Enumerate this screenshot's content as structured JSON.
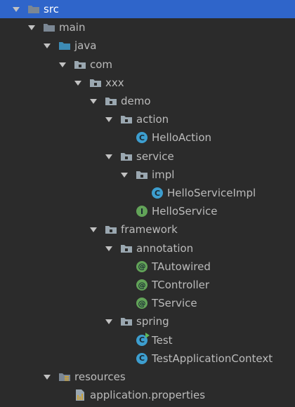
{
  "tree": [
    {
      "key": "src",
      "label": "src",
      "depth": 0,
      "expanded": true,
      "icon": "folder-icon",
      "icon_color": "#7b8794",
      "selected": true
    },
    {
      "key": "main",
      "label": "main",
      "depth": 1,
      "expanded": true,
      "icon": "folder-icon",
      "icon_color": "#7b8794"
    },
    {
      "key": "java",
      "label": "java",
      "depth": 2,
      "expanded": true,
      "icon": "source-folder-icon",
      "icon_color": "#3d8bb5"
    },
    {
      "key": "com",
      "label": "com",
      "depth": 3,
      "expanded": true,
      "icon": "package-icon",
      "icon_color": "#9aa7b0"
    },
    {
      "key": "xxx",
      "label": "xxx",
      "depth": 4,
      "expanded": true,
      "icon": "package-icon",
      "icon_color": "#9aa7b0"
    },
    {
      "key": "demo",
      "label": "demo",
      "depth": 5,
      "expanded": true,
      "icon": "package-icon",
      "icon_color": "#9aa7b0"
    },
    {
      "key": "action",
      "label": "action",
      "depth": 6,
      "expanded": true,
      "icon": "package-icon",
      "icon_color": "#9aa7b0"
    },
    {
      "key": "HelloAction",
      "label": "HelloAction",
      "depth": 7,
      "icon": "class-icon",
      "glyph": "C"
    },
    {
      "key": "service",
      "label": "service",
      "depth": 6,
      "expanded": true,
      "icon": "package-icon",
      "icon_color": "#9aa7b0"
    },
    {
      "key": "impl",
      "label": "impl",
      "depth": 7,
      "expanded": true,
      "icon": "package-icon",
      "icon_color": "#9aa7b0"
    },
    {
      "key": "HelloServiceImpl",
      "label": "HelloServiceImpl",
      "depth": 8,
      "icon": "class-icon",
      "glyph": "C"
    },
    {
      "key": "HelloService",
      "label": "HelloService",
      "depth": 7,
      "icon": "interface-icon",
      "glyph": "I"
    },
    {
      "key": "framework",
      "label": "framework",
      "depth": 5,
      "expanded": true,
      "icon": "package-icon",
      "icon_color": "#9aa7b0"
    },
    {
      "key": "annotation",
      "label": "annotation",
      "depth": 6,
      "expanded": true,
      "icon": "package-icon",
      "icon_color": "#9aa7b0"
    },
    {
      "key": "TAutowired",
      "label": "TAutowired",
      "depth": 7,
      "icon": "annotation-icon",
      "glyph": "@"
    },
    {
      "key": "TController",
      "label": "TController",
      "depth": 7,
      "icon": "annotation-icon",
      "glyph": "@"
    },
    {
      "key": "TService",
      "label": "TService",
      "depth": 7,
      "icon": "annotation-icon",
      "glyph": "@"
    },
    {
      "key": "spring",
      "label": "spring",
      "depth": 6,
      "expanded": true,
      "icon": "package-icon",
      "icon_color": "#9aa7b0"
    },
    {
      "key": "Test",
      "label": "Test",
      "depth": 7,
      "icon": "runnable-class-icon",
      "glyph": "C"
    },
    {
      "key": "TestApplicationContext",
      "label": "TestApplicationContext",
      "depth": 7,
      "icon": "class-icon",
      "glyph": "C"
    },
    {
      "key": "resources",
      "label": "resources",
      "depth": 2,
      "expanded": true,
      "icon": "resources-folder-icon",
      "icon_color": "#7b8794"
    },
    {
      "key": "application.properties",
      "label": "application.properties",
      "depth": 3,
      "icon": "properties-file-icon"
    }
  ],
  "colors": {
    "background": "#2b2b2b",
    "selection": "#2f65ca",
    "text": "#bbbbbb",
    "class_icon": "#3d9ecf",
    "interface_icon": "#62a358",
    "annotation_icon": "#62a358"
  }
}
